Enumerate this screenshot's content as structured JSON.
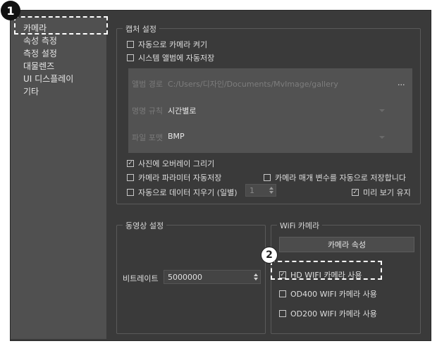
{
  "sidebar": {
    "items": [
      {
        "label": "카메라"
      },
      {
        "label": "속성 측정"
      },
      {
        "label": "측정 설정"
      },
      {
        "label": "대물렌즈"
      },
      {
        "label": "UI 디스플레이"
      },
      {
        "label": "기타"
      }
    ]
  },
  "capture": {
    "title": "캡처 설정",
    "auto_camera": {
      "label": "자동으로 카메라 켜기",
      "checked": false
    },
    "system_album_save": {
      "label": "시스템 앨범에 자동저장",
      "checked": false
    },
    "album_path": {
      "label": "앨범 경로",
      "value": "C:/Users/디자인/Documents/MvImage/gallery",
      "browse": "..."
    },
    "naming_rule": {
      "label": "명명 규칙",
      "value": "시간별로"
    },
    "file_format": {
      "label": "파일 포맷",
      "value": "BMP"
    },
    "overlay": {
      "label": "사진에 오버레이 그리기",
      "checked": true
    },
    "auto_save_params": {
      "label": "카메라 파라미터 자동저장",
      "checked": false
    },
    "auto_save_params_long": {
      "label": "카메라 매개 변수를 자동으로 저장합니다",
      "checked": false
    },
    "auto_clear_data": {
      "label": "자동으로 데이터 지우기 (일별)",
      "checked": false,
      "days": "1"
    },
    "keep_preview": {
      "label": "미리 보기 유지",
      "checked": true
    }
  },
  "video": {
    "title": "동영상 설정",
    "bitrate_label": "비트레이트",
    "bitrate_value": "5000000"
  },
  "wifi": {
    "title": "WiFi 카메라",
    "properties_button": "카메라 속성",
    "hd": {
      "label": "HD WIFI 카메라 사용",
      "checked": true
    },
    "od400": {
      "label": "OD400 WIFI 카메라 사용",
      "checked": false
    },
    "od200": {
      "label": "OD200 WIFI 카메라 사용",
      "checked": false
    }
  },
  "callouts": {
    "one": "1",
    "two": "2"
  },
  "colors": {
    "window_bg": "#3a3a3a",
    "sidebar_bg": "#505050",
    "disabled_panel": "#525252"
  }
}
